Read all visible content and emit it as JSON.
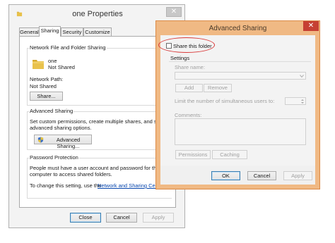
{
  "properties": {
    "title": "one Properties",
    "close_glyph": "✕",
    "tabs": [
      {
        "label": "General"
      },
      {
        "label": "Sharing"
      },
      {
        "label": "Security"
      },
      {
        "label": "Customize"
      }
    ],
    "network_sharing": {
      "legend": "Network File and Folder Sharing",
      "folder_name": "one",
      "folder_status": "Not Shared",
      "network_path_label": "Network Path:",
      "network_path_value": "Not Shared",
      "share_button": "Share..."
    },
    "advanced_sharing": {
      "legend": "Advanced Sharing",
      "description": [
        "Set custom permissions, create multiple shares, and set oth",
        "advanced sharing options."
      ],
      "button": "Advanced Sharing..."
    },
    "password_protection": {
      "legend": "Password Protection",
      "description": [
        "People must have a user account and password for this",
        "computer to access shared folders."
      ],
      "change_text": "To change this setting, use the",
      "link": "Network and Sharing Cente"
    },
    "buttons": {
      "close": "Close",
      "cancel": "Cancel",
      "apply": "Apply"
    }
  },
  "advanced_dialog": {
    "title": "Advanced Sharing",
    "close_glyph": "✕",
    "share_checkbox_label": "Share this folder",
    "share_checked": false,
    "settings_label": "Settings",
    "share_name_label": "Share name:",
    "add_button": "Add",
    "remove_button": "Remove",
    "limit_label": "Limit the number of simultaneous users to:",
    "comments_label": "Comments:",
    "permissions_button": "Permissions",
    "caching_button": "Caching",
    "ok_button": "OK",
    "cancel_button": "Cancel",
    "apply_button": "Apply"
  },
  "icons": {
    "folder_icon": "folder-icon",
    "shield_icon": "uac-shield-icon",
    "dropdown_icon": "chevron-down-icon",
    "spinner_icon": "spinner-arrows-icon"
  },
  "colors": {
    "dialog_frame": "#f0b984",
    "dialog_close": "#c64033",
    "annotation_ring": "#d93a3a",
    "link": "#0645ad"
  }
}
